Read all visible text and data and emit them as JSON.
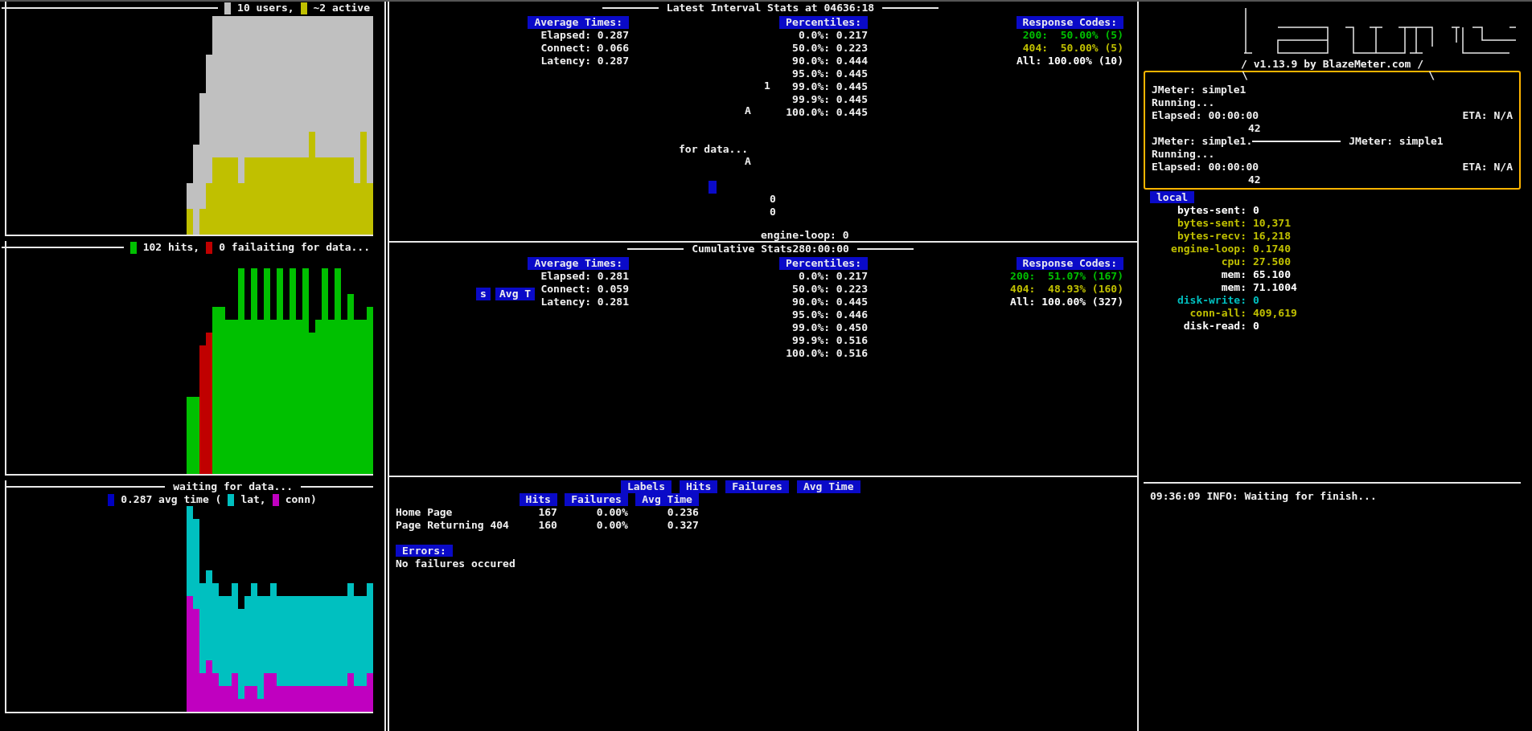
{
  "load_chart": {
    "legend": [
      {
        "text": "10 users,",
        "color": "#c0c0c0"
      },
      {
        "text": "~2 active",
        "color": "#c0c000"
      }
    ]
  },
  "hits_chart": {
    "legend": [
      {
        "text": "102 hits,",
        "color": "#00c000"
      },
      {
        "text": "0 failaiting for data...",
        "color": "#c00000"
      }
    ]
  },
  "time_chart": {
    "title": "waiting for data...",
    "legend": [
      {
        "text": "0.287 avg time (",
        "color": "#0000c0"
      },
      {
        "text": "lat,",
        "color": "#00c0c0"
      },
      {
        "text": "conn)",
        "color": "#c000c0"
      }
    ]
  },
  "interval_stats": {
    "title": "Latest Interval Stats at 04636:18",
    "average_times": {
      "heading": "Average Times:",
      "rows": [
        "Elapsed: 0.287",
        "Connect: 0.066",
        "Latency: 0.287"
      ]
    },
    "percentiles": {
      "heading": "Percentiles:",
      "rows": [
        "0.0%: 0.217",
        "50.0%: 0.223",
        "90.0%: 0.444",
        "95.0%: 0.445",
        "99.0%: 0.445",
        "99.9%: 0.445",
        "100.0%: 0.445"
      ]
    },
    "response_codes": {
      "heading": "Response Codes:",
      "rows": [
        {
          "text": "200:  50.00% (5)",
          "color": "#00c000"
        },
        {
          "text": "404:  50.00% (5)",
          "color": "#c0c000"
        },
        {
          "text": "All: 100.00% (10)",
          "color": "#ffffff"
        }
      ]
    },
    "stray_text": [
      {
        "text": "1",
        "kind": "plain"
      },
      {
        "text": "A",
        "kind": "plain"
      },
      {
        "text": "for data...",
        "kind": "plain"
      },
      {
        "text": "A",
        "kind": "plain"
      },
      {
        "text": "0",
        "kind": "plain"
      },
      {
        "text": "0",
        "kind": "plain"
      },
      {
        "text": "engine-loop: 0",
        "kind": "plain"
      }
    ]
  },
  "cumulative_stats": {
    "title": "Cumulative Stats280:00:00",
    "average_times": {
      "heading": "Average Times:",
      "rows": [
        "Elapsed: 0.281",
        "Connect: 0.059",
        "Latency: 0.281"
      ]
    },
    "percentiles": {
      "heading": "Percentiles:",
      "rows": [
        "0.0%: 0.217",
        "50.0%: 0.223",
        "90.0%: 0.445",
        "95.0%: 0.446",
        "99.0%: 0.450",
        "99.9%: 0.516",
        "100.0%: 0.516"
      ]
    },
    "response_codes": {
      "heading": "Response Codes:",
      "rows": [
        {
          "text": "200:  51.07% (167)",
          "color": "#00c000"
        },
        {
          "text": "404:  48.93% (160)",
          "color": "#c0c000"
        },
        {
          "text": "All: 100.00% (327)",
          "color": "#ffffff"
        }
      ]
    },
    "stray_text": [
      {
        "text": "s",
        "kind": "badge"
      },
      {
        "text": "Avg T",
        "kind": "badge"
      }
    ]
  },
  "labels_table": {
    "tabs": [
      "Labels",
      "Hits",
      "Failures",
      "Avg Time"
    ],
    "columns": [
      "",
      "Hits",
      "Failures",
      "Avg Time"
    ],
    "rows": [
      [
        "Home Page",
        "167",
        "0.00%",
        "0.236"
      ],
      [
        "Page Returning 404",
        "160",
        "0.00%",
        "0.327"
      ]
    ],
    "errors_heading": "Errors:",
    "errors_text": "No failures occured"
  },
  "logo": {
    "version": "/ v1.13.9 by BlazeMeter.com /",
    "marks": [
      "\\",
      "\\"
    ]
  },
  "executors": [
    {
      "name": "JMeter: simple1",
      "state": "Running...",
      "elapsed": "Elapsed: 00:00:00",
      "eta": "ETA: N/A",
      "count": "42"
    },
    {
      "name": "JMeter: simple1.",
      "overlay": "JMeter: simple1",
      "state": "Running...",
      "elapsed": "Elapsed: 00:00:00",
      "eta": "ETA: N/A",
      "count": "42"
    }
  ],
  "local_stats": {
    "heading": "local",
    "rows": [
      {
        "key": "bytes-sent:",
        "value": "0",
        "color": "#ffffff"
      },
      {
        "key": "bytes-sent:",
        "value": "10,371",
        "color": "#c0c000"
      },
      {
        "key": "bytes-recv:",
        "value": "16,218",
        "color": "#c0c000"
      },
      {
        "key": "engine-loop:",
        "value": "0.1740",
        "color": "#c0c000"
      },
      {
        "key": "cpu:",
        "value": "27.500",
        "color": "#c0c000"
      },
      {
        "key": "mem:",
        "value": "65.100",
        "color": "#ffffff"
      },
      {
        "key": "mem:",
        "value": "71.1004",
        "color": "#ffffff"
      },
      {
        "key": "disk-write:",
        "value": "0",
        "color": "#00c0c0"
      },
      {
        "key": "conn-all:",
        "value": "409,619",
        "color": "#c0c000"
      },
      {
        "key": "disk-read:",
        "value": "0",
        "color": "#ffffff"
      }
    ]
  },
  "log": [
    "09:36:09 INFO: Waiting for finish..."
  ]
}
